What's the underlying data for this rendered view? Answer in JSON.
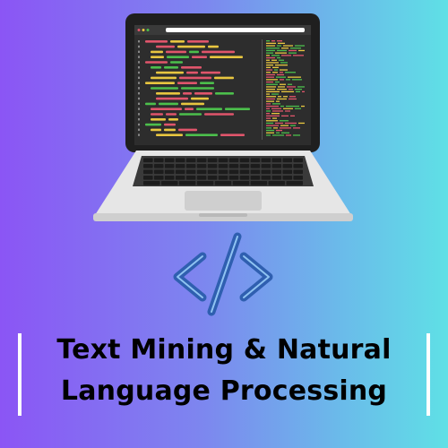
{
  "title": {
    "line1": "Text Mining & Natural",
    "line2": "Language Processing"
  },
  "icons": {
    "laptop": "laptop-with-code-icon",
    "code": "code-brackets-icon"
  },
  "colors": {
    "gradient_left": "#8b55f5",
    "gradient_right": "#5fe0e6",
    "code_icon": "#2f5fb0",
    "screen": "#2b2b2b",
    "code_green": "#4cbf4c",
    "code_red": "#e0556b",
    "code_yellow": "#e8c640"
  }
}
